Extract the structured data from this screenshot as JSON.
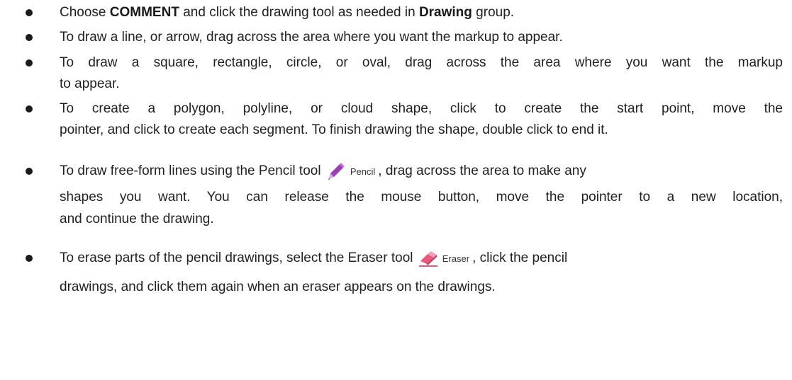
{
  "bullets": [
    {
      "lines": [
        {
          "parts": [
            {
              "t": "Choose "
            },
            {
              "t": "COMMENT",
              "b": true
            },
            {
              "t": " and click the drawing tool as needed in "
            },
            {
              "t": "Drawing",
              "b": true
            },
            {
              "t": " group."
            }
          ]
        }
      ]
    },
    {
      "lines": [
        {
          "text": "To draw a line, or arrow, drag across the area where you want the markup to appear."
        }
      ]
    },
    {
      "lines": [
        {
          "text": "To draw a square, rectangle, circle, or oval, drag across the area where you want the markup"
        },
        {
          "text": "to appear."
        }
      ]
    },
    {
      "lines": [
        {
          "text": "To create a polygon, polyline, or cloud shape, click to create the start point, move the"
        },
        {
          "text": "pointer, and click to create each segment. To finish drawing the shape, double click to end it."
        }
      ]
    },
    {
      "lines": [
        {
          "before": "To draw free-form lines using the Pencil tool",
          "after": ", drag across the area to make any"
        },
        {
          "text": "shapes you want. You can release the mouse button, move the pointer to a new location,"
        },
        {
          "text": "and continue the drawing."
        }
      ]
    },
    {
      "lines": [
        {
          "before": "To erase parts of the pencil drawings, select the Eraser tool",
          "after": ", click the pencil"
        },
        {
          "text": "drawings, and click them again when an eraser appears on the drawings."
        }
      ]
    }
  ],
  "tools": {
    "pencil": {
      "label": "Pencil",
      "icon": "pencil-icon",
      "color": "#9b3fb5"
    },
    "eraser": {
      "label": "Eraser",
      "icon": "eraser-icon",
      "color": "#e8587a"
    }
  },
  "colors": {
    "text": "#222222",
    "bullet": "#1b1b1b"
  }
}
